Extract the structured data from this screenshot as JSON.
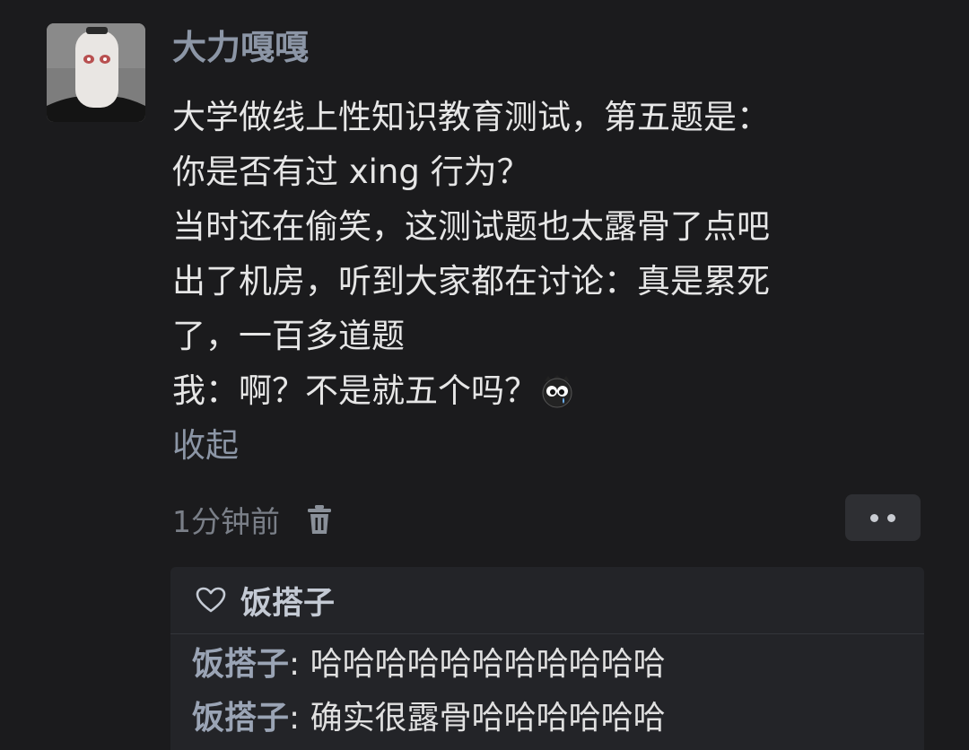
{
  "comment": {
    "author": "大力嘎嘎",
    "lines": [
      "大学做线上性知识教育测试，第五题是：",
      "你是否有过 xing 行为？",
      "当时还在偷笑，这测试题也太露骨了点吧",
      "出了机房，听到大家都在讨论：真是累死",
      "了，一百多道题",
      "我：啊？不是就五个吗？"
    ],
    "collapse_label": "收起",
    "timestamp": "1分钟前"
  },
  "likes": {
    "names": "饭搭子"
  },
  "replies": [
    {
      "name": "饭搭子",
      "separator": ": ",
      "text": "哈哈哈哈哈哈哈哈哈哈哈"
    },
    {
      "name": "饭搭子",
      "separator": ": ",
      "text": "确实很露骨哈哈哈哈哈哈"
    }
  ],
  "icons": {
    "avatar": "avatar-photo",
    "emoji": "crying-emoji",
    "delete": "trash-icon",
    "more": "more-dots-icon",
    "like": "heart-icon"
  },
  "colors": {
    "background": "#1b1b1d",
    "author_name": "#8c96a6",
    "body_text": "#e6e6e6",
    "reply_box": "#232428"
  }
}
